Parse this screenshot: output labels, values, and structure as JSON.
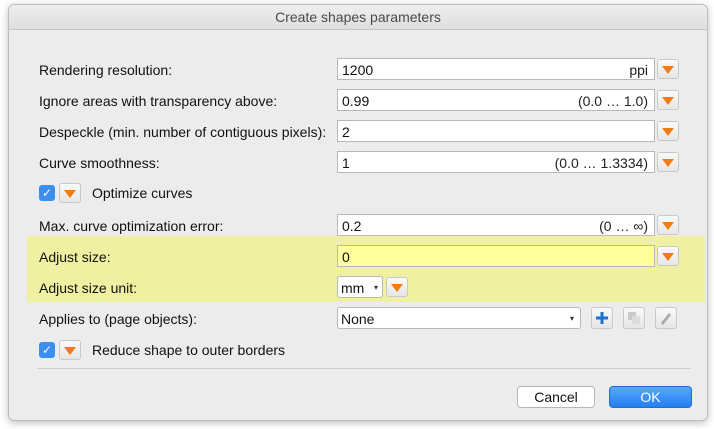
{
  "dialog": {
    "title": "Create shapes parameters"
  },
  "fields": {
    "rendering_resolution": {
      "label": "Rendering resolution:",
      "value": "1200",
      "hint": "ppi"
    },
    "ignore_transparency": {
      "label": "Ignore areas with transparency above:",
      "value": "0.99",
      "hint": "(0.0 … 1.0)"
    },
    "despeckle": {
      "label": "Despeckle (min. number of contiguous pixels):",
      "value": "2",
      "hint": ""
    },
    "curve_smoothness": {
      "label": "Curve smoothness:",
      "value": "1",
      "hint": "(0.0 … 1.3334)"
    },
    "optimize_curves": {
      "label": "Optimize curves",
      "checked": true
    },
    "max_curve_error": {
      "label": "Max. curve optimization error:",
      "value": "0.2",
      "hint": "(0 … ∞)"
    },
    "adjust_size": {
      "label": "Adjust size:",
      "value": "0"
    },
    "adjust_size_unit": {
      "label": "Adjust size unit:",
      "value": "mm"
    },
    "applies_to": {
      "label": "Applies to (page objects):",
      "value": "None"
    },
    "reduce_shape": {
      "label": "Reduce shape to outer borders",
      "checked": true
    }
  },
  "buttons": {
    "cancel": "Cancel",
    "ok": "OK"
  },
  "colors": {
    "highlight": "#f0f0a3",
    "accent_orange": "#f07c12",
    "checkbox_blue": "#3a8ff0",
    "ok_blue": "#237ff0"
  },
  "icons": {
    "add": "plus-icon",
    "duplicate": "copy-icon",
    "edit": "pencil-icon",
    "dropdown": "triangle-down-icon"
  }
}
